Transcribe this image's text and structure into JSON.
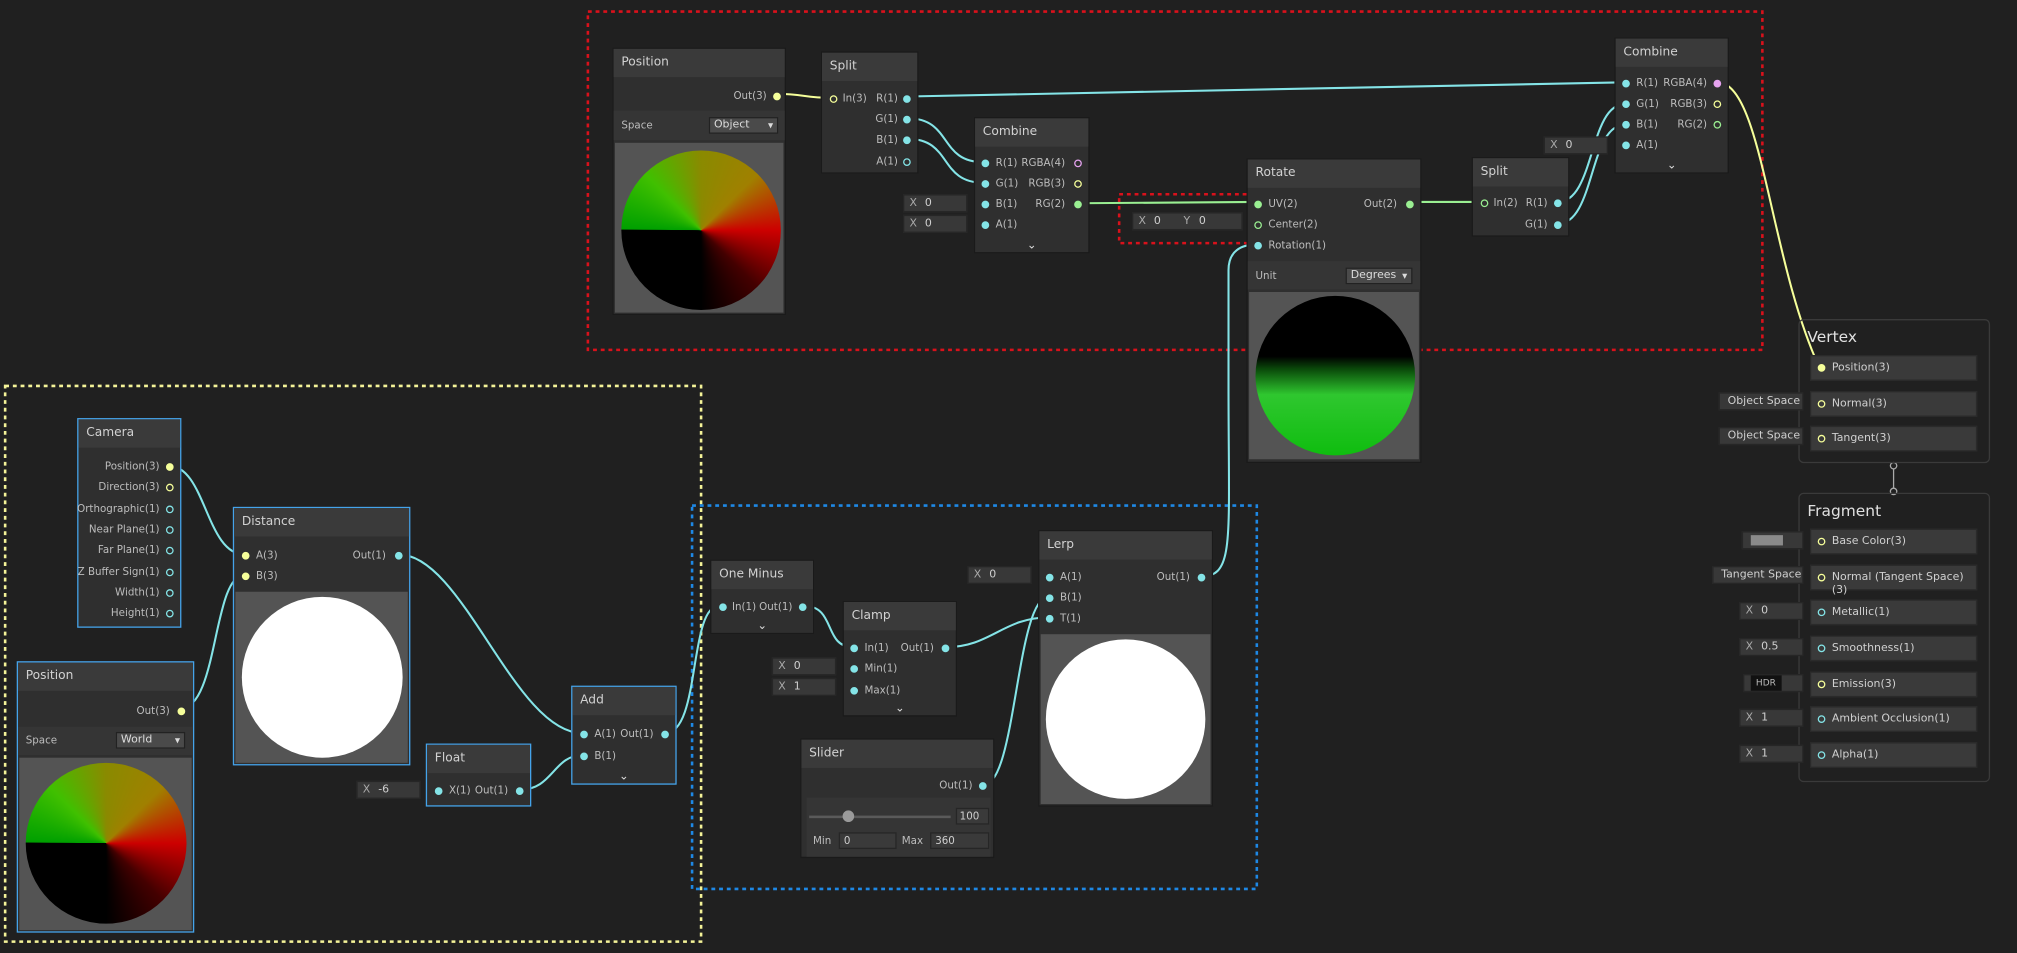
{
  "nodes": {
    "position_top": {
      "title": "Position",
      "out": "Out(3)",
      "space_label": "Space",
      "space_value": "Object"
    },
    "split_top": {
      "title": "Split",
      "in": "In(3)",
      "outs": [
        "R(1)",
        "G(1)",
        "B(1)",
        "A(1)"
      ]
    },
    "combine_mid": {
      "title": "Combine",
      "ins": [
        "R(1)",
        "G(1)",
        "B(1)",
        "A(1)"
      ],
      "outs": [
        "RGBA(4)",
        "RGB(3)",
        "RG(2)"
      ],
      "b_x": "0",
      "a_x": "0"
    },
    "rotate": {
      "title": "Rotate",
      "ins": [
        "UV(2)",
        "Center(2)",
        "Rotation(1)"
      ],
      "out": "Out(2)",
      "unit_label": "Unit",
      "unit_value": "Degrees",
      "center_x": "0",
      "center_y": "0"
    },
    "split_right": {
      "title": "Split",
      "in": "In(2)",
      "outs": [
        "R(1)",
        "G(1)"
      ]
    },
    "combine_right": {
      "title": "Combine",
      "ins": [
        "R(1)",
        "G(1)",
        "B(1)",
        "A(1)"
      ],
      "outs": [
        "RGBA(4)",
        "RGB(3)",
        "RG(2)"
      ],
      "a_x": "0"
    },
    "camera": {
      "title": "Camera",
      "outs": [
        "Position(3)",
        "Direction(3)",
        "Orthographic(1)",
        "Near Plane(1)",
        "Far Plane(1)",
        "Z Buffer Sign(1)",
        "Width(1)",
        "Height(1)"
      ]
    },
    "distance": {
      "title": "Distance",
      "ins": [
        "A(3)",
        "B(3)"
      ],
      "out": "Out(1)"
    },
    "position_bottom": {
      "title": "Position",
      "out": "Out(3)",
      "space_label": "Space",
      "space_value": "World"
    },
    "float": {
      "title": "Float",
      "in": "X(1)",
      "out": "Out(1)",
      "x_value": "-6"
    },
    "add": {
      "title": "Add",
      "ins": [
        "A(1)",
        "B(1)"
      ],
      "out": "Out(1)"
    },
    "one_minus": {
      "title": "One Minus",
      "in": "In(1)",
      "out": "Out(1)"
    },
    "clamp": {
      "title": "Clamp",
      "ins": [
        "In(1)",
        "Min(1)",
        "Max(1)"
      ],
      "out": "Out(1)",
      "min_x": "0",
      "max_x": "1"
    },
    "slider": {
      "title": "Slider",
      "out": "Out(1)",
      "value": "100",
      "min_label": "Min",
      "min_value": "0",
      "max_label": "Max",
      "max_value": "360",
      "level": 0.27
    },
    "lerp": {
      "title": "Lerp",
      "ins": [
        "A(1)",
        "B(1)",
        "T(1)"
      ],
      "out": "Out(1)",
      "a_x": "0"
    }
  },
  "x_label": "X",
  "y_label": "Y",
  "master": {
    "vertex": {
      "title": "Vertex",
      "slots": [
        "Position(3)",
        "Normal(3)",
        "Tangent(3)"
      ],
      "normal_space": "Object Space",
      "tangent_space": "Object Space"
    },
    "fragment": {
      "title": "Fragment",
      "slots": [
        "Base Color(3)",
        "Normal (Tangent Space)(3)",
        "Metallic(1)",
        "Smoothness(1)",
        "Emission(3)",
        "Ambient Occlusion(1)",
        "Alpha(1)"
      ],
      "normal_space": "Tangent Space",
      "metallic": "0",
      "smoothness": "0.5",
      "emission": "HDR",
      "ao": "1",
      "alpha": "1",
      "base_color": "#8a8a8a"
    }
  },
  "colors": {
    "vector1": "#84e4e7",
    "vector2": "#9aef92",
    "vector3": "#f6ff9a",
    "vector4": "#e5a2ef",
    "selection": "#44a3ea",
    "group_red": "#d9111b",
    "group_yellow": "#f4f398",
    "group_blue": "#1e88e5"
  }
}
